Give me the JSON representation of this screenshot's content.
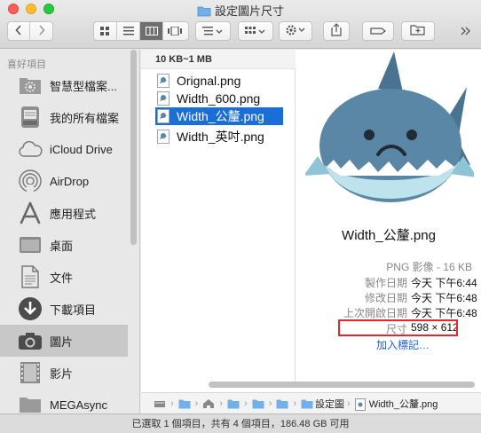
{
  "window": {
    "title": "設定圖片尺寸"
  },
  "toolbar": {
    "back_icon": "chevron-left-icon",
    "forward_icon": "chevron-right-icon",
    "view_modes": [
      "icon-view",
      "list-view",
      "column-view",
      "cover-flow-view"
    ],
    "active_view": "column-view",
    "arrange_icon": "arrange-icon",
    "group_icon": "group-icon",
    "action_icon": "gear-icon",
    "share_icon": "share-icon",
    "tag_icon": "tag-icon",
    "new_folder_icon": "new-folder-icon",
    "expand_icon": "expand-icon"
  },
  "sidebar": {
    "heading": "喜好項目",
    "items": [
      {
        "label": "智慧型檔案...",
        "icon": "smart-folder-icon",
        "selected": false
      },
      {
        "label": "我的所有檔案",
        "icon": "all-files-icon",
        "selected": false
      },
      {
        "label": "iCloud Drive",
        "icon": "cloud-icon",
        "selected": false
      },
      {
        "label": "AirDrop",
        "icon": "airdrop-icon",
        "selected": false
      },
      {
        "label": "應用程式",
        "icon": "applications-icon",
        "selected": false
      },
      {
        "label": "桌面",
        "icon": "desktop-icon",
        "selected": false
      },
      {
        "label": "文件",
        "icon": "documents-icon",
        "selected": false
      },
      {
        "label": "下載項目",
        "icon": "downloads-icon",
        "selected": false
      },
      {
        "label": "圖片",
        "icon": "camera-icon",
        "selected": true
      },
      {
        "label": "影片",
        "icon": "film-icon",
        "selected": false
      },
      {
        "label": "MEGAsync",
        "icon": "folder-icon",
        "selected": false
      }
    ]
  },
  "column": {
    "header": "10 KB~1 MB",
    "files": [
      {
        "name": "Orignal.png",
        "selected": false
      },
      {
        "name": "Width_600.png",
        "selected": false
      },
      {
        "name": "Width_公釐.png",
        "selected": true
      },
      {
        "name": "Width_英吋.png",
        "selected": false
      }
    ]
  },
  "preview": {
    "file_name": "Width_公釐.png",
    "kind": "PNG 影像 - 16 KB",
    "info": [
      {
        "key": "製作日期",
        "value": "今天 下午6:44"
      },
      {
        "key": "修改日期",
        "value": "今天 下午6:48"
      },
      {
        "key": "上次開啟日期",
        "value": "今天 下午6:48"
      },
      {
        "key": "尺寸",
        "value": "598 × 612"
      }
    ],
    "add_tags": "加入標記…",
    "highlight_color": "#e8262b"
  },
  "pathbar": {
    "segments": [
      "設定圖",
      "Width_公釐.png"
    ]
  },
  "status": {
    "text": "已選取 1 個項目，共有 4 個項目，186.48 GB 可用"
  },
  "colors": {
    "selection": "#1a6ed8",
    "shark_body": "#5b87a6",
    "shark_belly": "#bfe3ec"
  }
}
